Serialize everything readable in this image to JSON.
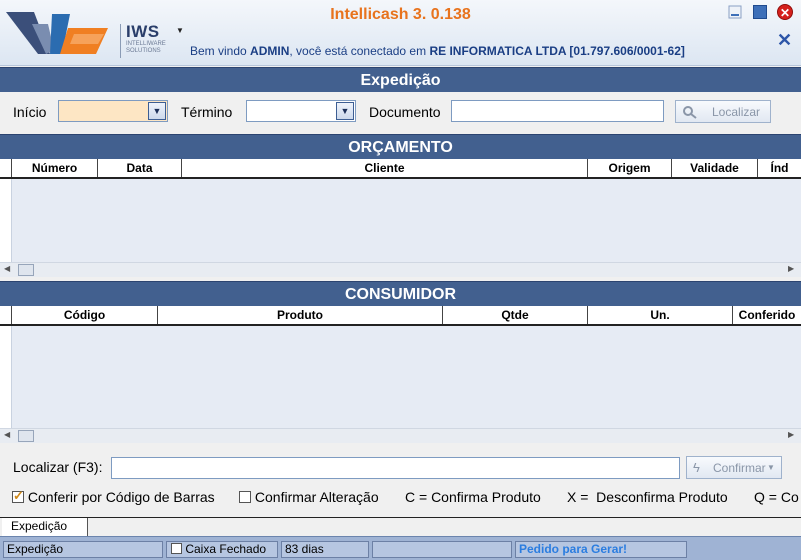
{
  "app": {
    "title": "Intellicash 3. 0.138",
    "logo_text": "IWS",
    "logo_sub": "INTELLIWARE SOLUTIONS",
    "welcome_prefix": "Bem vindo ",
    "welcome_user": "ADMIN",
    "welcome_mid": ", você está conectado em ",
    "welcome_company": "RE INFORMATICA LTDA [01.797.606/0001-62]",
    "close_glyph": "✕",
    "x_glyph": "✕"
  },
  "expedicao": {
    "title": "Expedição",
    "inicio_label": "Início",
    "termino_label": "Término",
    "documento_label": "Documento",
    "localizar_label": "Localizar",
    "inicio_value": "",
    "termino_value": "",
    "documento_value": ""
  },
  "orcamento": {
    "title": "ORÇAMENTO",
    "columns": [
      "Número",
      "Data",
      "Cliente",
      "Origem",
      "Validade",
      "Índ"
    ]
  },
  "consumidor": {
    "title": "CONSUMIDOR",
    "columns": [
      "Código",
      "Produto",
      "Qtde",
      "Un.",
      "Conferido"
    ]
  },
  "search": {
    "label": "Localizar (F3):",
    "value": "",
    "confirm_label": "Confirmar"
  },
  "options": {
    "barcode_label": "Conferir por Código de Barras",
    "barcode_checked": true,
    "confirm_alter_label": "Confirmar Alteração",
    "confirm_alter_checked": false,
    "hint_c": "C = Confirma Produto",
    "hint_x": "X =  Desconfirma Produto",
    "hint_q": "Q = Co"
  },
  "tab": {
    "label": "Expedição"
  },
  "status": {
    "screen": "Expedição",
    "caixa": "Caixa Fechado",
    "days": "83 dias",
    "empty": "",
    "pedido": "Pedido para Gerar!"
  },
  "colors": {
    "accent": "#42608f",
    "title_orange": "#e8731d",
    "status_bar": "#9fb3d4"
  }
}
